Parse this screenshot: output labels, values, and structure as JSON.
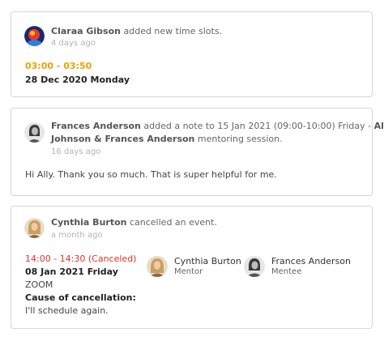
{
  "activities": [
    {
      "actor": "Claraa Gibson",
      "action": "added new time slots.",
      "time_ago": "4 days ago",
      "slot_time": "03:00 - 03:50",
      "slot_date": "28 Dec 2020 Monday"
    },
    {
      "actor": "Frances Anderson",
      "action_part1": "added a note to 15 Jan 2021 (09:00-10:00) Friday -",
      "highlight_part1": "Ally",
      "highlight_part2": "Johnson & Frances Anderson",
      "action_part2": "mentoring session.",
      "time_ago": "16 days ago",
      "note": "Hi Ally. Thank you so much. That is super helpful for me."
    },
    {
      "actor": "Cynthia Burton",
      "action": "cancelled an event.",
      "time_ago": "a month ago",
      "event_time": "14:00 - 14:30",
      "event_status": "(Canceled)",
      "event_date": "08 Jan 2021 Friday",
      "event_location": "ZOOM",
      "cancel_label": "Cause of cancellation:",
      "cancel_reason": "I'll schedule again.",
      "participants": [
        {
          "name": "Cynthia Burton",
          "role": "Mentor"
        },
        {
          "name": "Frances Anderson",
          "role": "Mentee"
        }
      ]
    }
  ],
  "colors": {
    "accent_orange": "#f0a000",
    "cancel_red": "#e0302a",
    "border": "#d6d6d6",
    "muted": "#b3b3b3"
  },
  "icons": {
    "avatar_claraa": "colorful-avatar-icon",
    "avatar_frances": "grayscale-portrait-avatar",
    "avatar_cynthia": "blonde-portrait-avatar"
  }
}
